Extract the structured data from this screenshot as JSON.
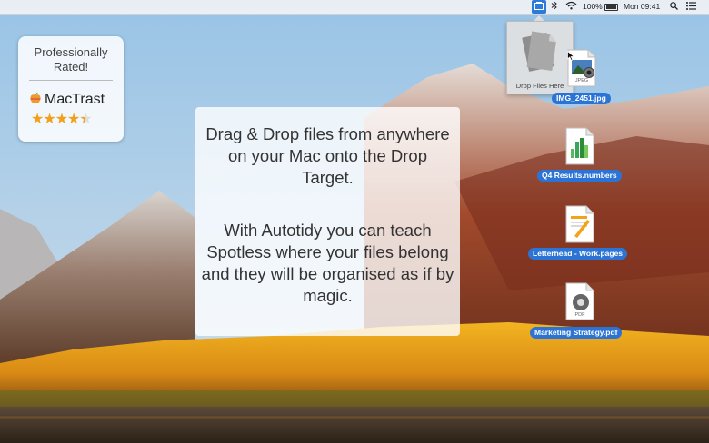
{
  "menubar": {
    "battery_percent": "100%",
    "clock": "Mon 09:41",
    "icons": [
      "spotless-menu-icon",
      "bluetooth-icon",
      "wifi-icon",
      "battery-icon",
      "spotlight-icon",
      "notification-center-icon"
    ]
  },
  "badge": {
    "rated_line1": "Professionally",
    "rated_line2": "Rated!",
    "brand": "MacTrast",
    "stars": "★★★★",
    "half_star": "★",
    "rating": 4.5
  },
  "card": {
    "paragraph1": "Drag & Drop files from anywhere on your Mac onto the Drop Target.",
    "paragraph2": "With Autotidy you can teach Spotless where your files belong and they will be organised as if by magic."
  },
  "drop_target": {
    "label": "Drop Files Here"
  },
  "files": [
    {
      "name": "IMG_2451.jpg",
      "badge": "JPEG"
    },
    {
      "name": "Q4 Results.numbers",
      "badge": ""
    },
    {
      "name": "Letterhead - Work.pages",
      "badge": ""
    },
    {
      "name": "Marketing Strategy.pdf",
      "badge": "PDF"
    }
  ],
  "colors": {
    "selection_blue": "#2b74d6",
    "star_orange": "#f2a01a",
    "menubar_highlight": "#2d7bd8"
  }
}
